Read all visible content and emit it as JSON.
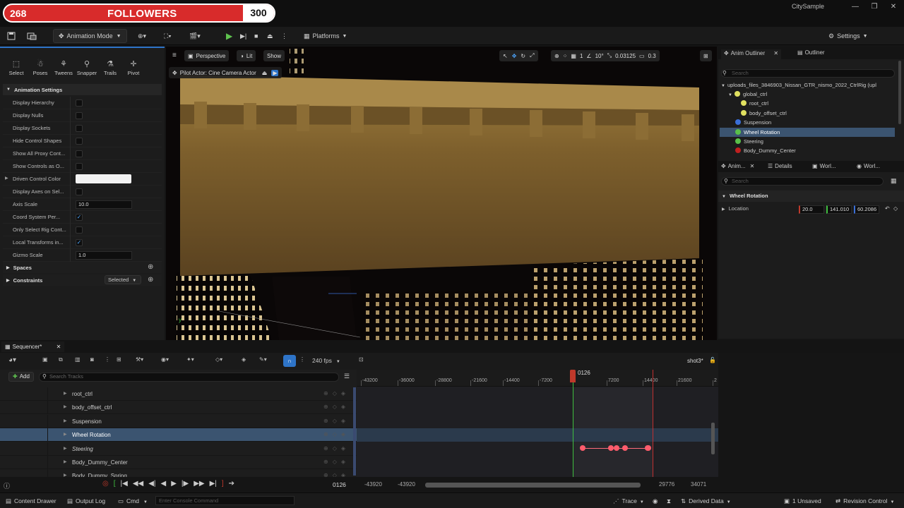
{
  "overlay": {
    "left_count": "268",
    "label": "FOLLOWERS",
    "right_count": "300"
  },
  "window": {
    "title": "CitySample"
  },
  "toolbar": {
    "mode": "Animation Mode",
    "platforms": "Platforms",
    "settings": "Settings"
  },
  "anim_tools": [
    "Select",
    "Poses",
    "Tweens",
    "Snapper",
    "Trails",
    "Pivot"
  ],
  "anim_settings": {
    "header": "Animation Settings",
    "rows": [
      {
        "label": "Display Hierarchy",
        "type": "check",
        "checked": false
      },
      {
        "label": "Display Nulls",
        "type": "check",
        "checked": false
      },
      {
        "label": "Display Sockets",
        "type": "check",
        "checked": false
      },
      {
        "label": "Hide Control Shapes",
        "type": "check",
        "checked": false
      },
      {
        "label": "Show All Proxy Cont...",
        "type": "check",
        "checked": false
      },
      {
        "label": "Show Controls as O...",
        "type": "check",
        "checked": false
      },
      {
        "label": "Driven Control Color",
        "type": "color"
      },
      {
        "label": "Display Axes on Sel...",
        "type": "check",
        "checked": false
      },
      {
        "label": "Axis Scale",
        "type": "number",
        "value": "10.0"
      },
      {
        "label": "Coord System Per...",
        "type": "check",
        "checked": true
      },
      {
        "label": "Only Select Rig Cont...",
        "type": "check",
        "checked": false
      },
      {
        "label": "Local Transforms in...",
        "type": "check",
        "checked": true
      },
      {
        "label": "Gizmo Scale",
        "type": "number",
        "value": "1.0"
      }
    ],
    "spaces": "Spaces",
    "constraints": "Constraints",
    "constraints_value": "Selected"
  },
  "viewport": {
    "perspective": "Perspective",
    "lit": "Lit",
    "show": "Show",
    "pilot": "Pilot Actor: Cine Camera Actor",
    "grid_size": "1",
    "angle": "10°",
    "scale": "0.03125",
    "cam_speed": "0.3"
  },
  "outliner": {
    "tab_anim": "Anim Outliner",
    "tab_outliner": "Outliner",
    "search_placeholder": "Search",
    "root": "uploads_files_3846903_Nissan_GTR_nismo_2022_CtrlRig (upl",
    "items": [
      {
        "label": "global_ctrl",
        "color": "#e0e060",
        "indent": 1
      },
      {
        "label": "root_ctrl",
        "color": "#e0e060",
        "indent": 2
      },
      {
        "label": "body_offset_ctrl",
        "color": "#e0e060",
        "indent": 2
      },
      {
        "label": "Suspension",
        "color": "#3a6fd8",
        "indent": 1
      },
      {
        "label": "Wheel Rotation",
        "color": "#59c04a",
        "indent": 1,
        "selected": true
      },
      {
        "label": "Steering",
        "color": "#59c04a",
        "indent": 1
      },
      {
        "label": "Body_Dummy_Center",
        "color": "#c02020",
        "indent": 1
      }
    ]
  },
  "details": {
    "tabs": [
      "Anim...",
      "Details",
      "Worl...",
      "Worl..."
    ],
    "search_placeholder": "Search",
    "section": "Wheel Rotation",
    "prop_label": "Location",
    "values": [
      "20.0",
      "141.010",
      "60.2086"
    ]
  },
  "sequencer": {
    "tab": "Sequencer*",
    "fps": "240 fps",
    "shot": "shot3*",
    "add": "Add",
    "search_placeholder": "Search Tracks",
    "tracks": [
      {
        "label": "root_ctrl",
        "italic": false
      },
      {
        "label": "body_offset_ctrl",
        "italic": false
      },
      {
        "label": "Suspension",
        "italic": false
      },
      {
        "label": "Wheel Rotation",
        "italic": false,
        "selected": true
      },
      {
        "label": "Steering",
        "italic": true
      },
      {
        "label": "Body_Dummy_Center",
        "italic": false
      },
      {
        "label": "Body_Dummy_Spring",
        "italic": false
      }
    ],
    "ticks": [
      "-43200",
      "-36000",
      "-28800",
      "-21600",
      "-14400",
      "-7200",
      "7200",
      "14400",
      "21600",
      "2"
    ],
    "playhead": "0126",
    "current_frame": "0126",
    "range_start": "-43920",
    "range_start2": "-43920",
    "range_end": "29776",
    "range_end2": "34071"
  },
  "status": {
    "content_drawer": "Content Drawer",
    "output_log": "Output Log",
    "cmd": "Cmd",
    "console_placeholder": "Enter Console Command",
    "trace": "Trace",
    "derived": "Derived Data",
    "unsaved": "1 Unsaved",
    "revision": "Revision Control"
  }
}
